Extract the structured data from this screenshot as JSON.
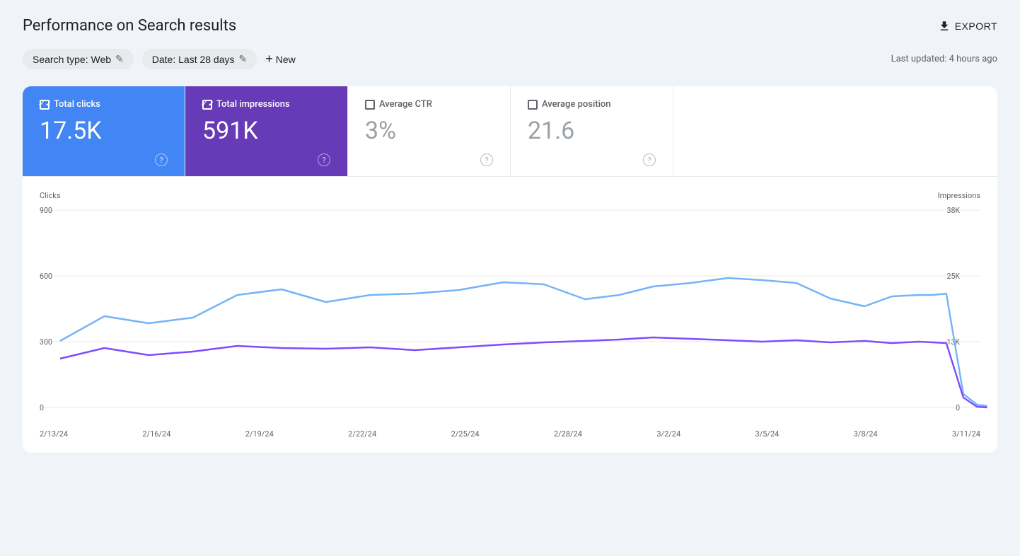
{
  "header": {
    "title": "Performance on Search results",
    "export_label": "EXPORT"
  },
  "filters": {
    "search_type_label": "Search type: Web",
    "date_label": "Date: Last 28 days",
    "new_label": "New",
    "last_updated": "Last updated: 4 hours ago"
  },
  "metrics": [
    {
      "id": "total-clicks",
      "label": "Total clicks",
      "value": "17.5K",
      "active": true,
      "style": "active-blue",
      "checked": true
    },
    {
      "id": "total-impressions",
      "label": "Total impressions",
      "value": "591K",
      "active": true,
      "style": "active-purple",
      "checked": true
    },
    {
      "id": "average-ctr",
      "label": "Average CTR",
      "value": "3%",
      "active": false,
      "style": "inactive",
      "checked": false
    },
    {
      "id": "average-position",
      "label": "Average position",
      "value": "21.6",
      "active": false,
      "style": "inactive",
      "checked": false
    }
  ],
  "chart": {
    "left_axis_label": "Clicks",
    "right_axis_label": "Impressions",
    "left_ticks": [
      "900",
      "600",
      "300",
      "0"
    ],
    "right_ticks": [
      "38K",
      "25K",
      "13K",
      "0"
    ],
    "x_labels": [
      "2/13/24",
      "2/16/24",
      "2/19/24",
      "2/22/24",
      "2/25/24",
      "2/28/24",
      "3/2/24",
      "3/5/24",
      "3/8/24",
      "3/11/24"
    ],
    "blue_line_points": "0,180 60,130 120,140 180,135 240,100 300,95 360,115 420,108 480,105 540,100 600,90 650,92 700,110 750,108 800,95 850,90 900,85 950,88 1000,95 1050,110 1100,120 1150,108 1200,108 1250,108 1300,105 1350,350 1400,385 1440,388",
    "purple_line_points": "0,210 60,190 120,200 180,195 240,185 300,190 360,190 420,188 480,192 540,190 600,185 650,182 700,180 750,178 800,175 850,175 900,172 950,175 1000,178 1050,180 1100,178 1150,182 1200,180 1250,180 1300,182 1350,355 1400,388 1440,390",
    "colors": {
      "blue": "#74b3f8",
      "purple": "#7c4dff",
      "grid": "#e8eaed"
    }
  }
}
